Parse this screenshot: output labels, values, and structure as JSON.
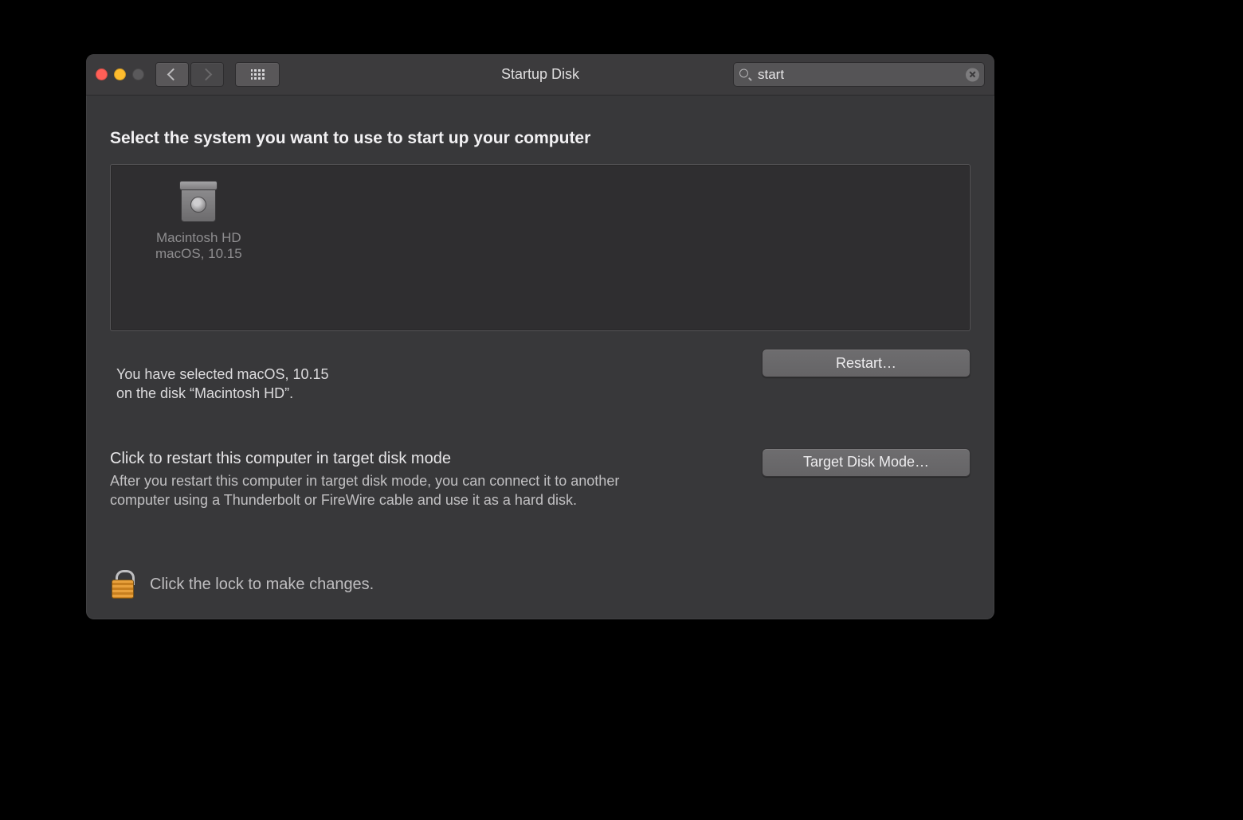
{
  "window": {
    "title": "Startup Disk"
  },
  "search": {
    "value": "start"
  },
  "main": {
    "heading": "Select the system you want to use to start up your computer"
  },
  "disks": [
    {
      "name": "Macintosh HD",
      "os_label": "macOS, 10.15"
    }
  ],
  "selected": {
    "line1": "You have selected macOS, 10.15",
    "line2": "on the disk “Macintosh HD”."
  },
  "buttons": {
    "restart": "Restart…",
    "target_disk_mode": "Target Disk Mode…"
  },
  "target": {
    "heading": "Click to restart this computer in target disk mode",
    "description": "After you restart this computer in target disk mode, you can connect it to another computer using a Thunderbolt or FireWire cable and use it as a hard disk."
  },
  "lock": {
    "text": "Click the lock to make changes."
  }
}
